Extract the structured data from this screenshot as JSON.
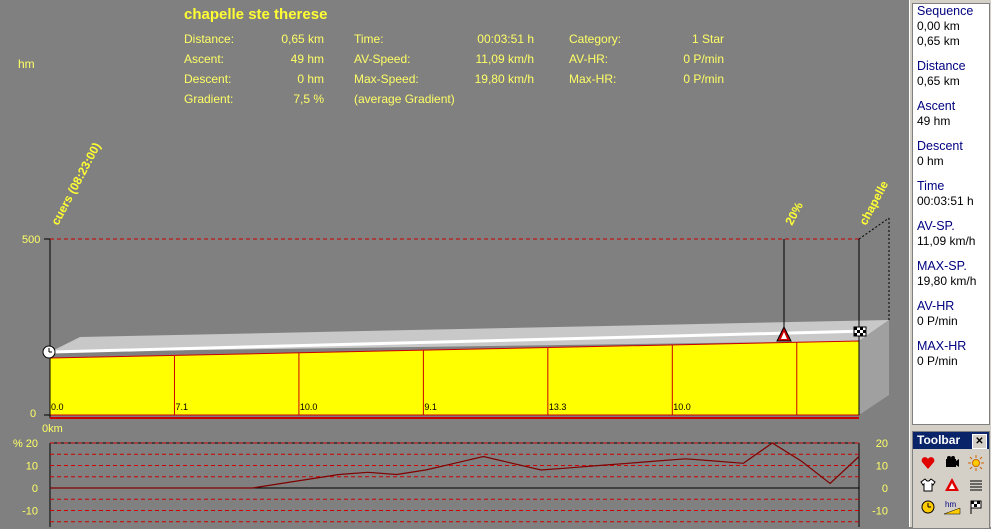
{
  "title": "chapelle ste therese",
  "unit_hm": "hm",
  "stats": {
    "distance_label": "Distance:",
    "distance_value": "0,65 km",
    "ascent_label": "Ascent:",
    "ascent_value": "49 hm",
    "descent_label": "Descent:",
    "descent_value": "0 hm",
    "gradient_label": "Gradient:",
    "gradient_value": "7,5 %",
    "time_label": "Time:",
    "time_value": "00:03:51 h",
    "avspeed_label": "AV-Speed:",
    "avspeed_value": "11,09 km/h",
    "maxspeed_label": "Max-Speed:",
    "maxspeed_value": "19,80 km/h",
    "avg_gradient_note": "(average Gradient)",
    "category_label": "Category:",
    "category_value": "1 Star",
    "avhr_label": "AV-HR:",
    "avhr_value": "0 P/min",
    "maxhr_label": "Max-HR:",
    "maxhr_value": "0 P/min"
  },
  "profile": {
    "start_label": "cuers (08:23:00)",
    "end_label": "chapelle",
    "peak_label": "20%",
    "y_max_label": "500",
    "y_min_label": "0",
    "x_start_label": "0km",
    "segment_gradients": [
      "0.0",
      "7.1",
      "10.0",
      "9.1",
      "13.3",
      "10.0"
    ]
  },
  "gradient_chart": {
    "y_label": "%",
    "left_ticks": [
      "20",
      "10",
      "0",
      "-10"
    ],
    "right_ticks": [
      "20",
      "10",
      "0",
      "-10"
    ],
    "values": [
      0,
      0,
      0,
      0,
      0,
      0,
      0,
      0,
      2,
      4,
      6,
      7,
      6,
      8,
      11,
      14,
      11,
      8,
      9,
      10,
      11,
      12,
      13,
      12,
      11,
      20,
      12,
      2,
      14
    ]
  },
  "sidebar": {
    "items": [
      {
        "title": "Sequence",
        "values": [
          "0,00 km",
          "0,65 km"
        ]
      },
      {
        "title": "Distance",
        "values": [
          "0,65 km"
        ]
      },
      {
        "title": "Ascent",
        "values": [
          "49 hm"
        ]
      },
      {
        "title": "Descent",
        "values": [
          "0 hm"
        ]
      },
      {
        "title": "Time",
        "values": [
          "00:03:51 h"
        ]
      },
      {
        "title": "AV-SP.",
        "values": [
          "11,09 km/h"
        ]
      },
      {
        "title": "MAX-SP.",
        "values": [
          "19,80 km/h"
        ]
      },
      {
        "title": "AV-HR",
        "values": [
          "0 P/min"
        ]
      },
      {
        "title": "MAX-HR",
        "values": [
          "0 P/min"
        ]
      }
    ]
  },
  "toolbar": {
    "title": "Toolbar",
    "close": "✕",
    "buttons": [
      "heart-icon",
      "camera-icon",
      "sun-icon",
      "shirt-icon",
      "warning-icon",
      "list-icon",
      "clock-icon",
      "hm-icon",
      "flag-icon"
    ],
    "hm_text": "hm"
  },
  "colors": {
    "background": "#808080",
    "label_yellow": "#ffff66",
    "fill_yellow": "#ffff00",
    "grid_red": "#cc0000"
  }
}
